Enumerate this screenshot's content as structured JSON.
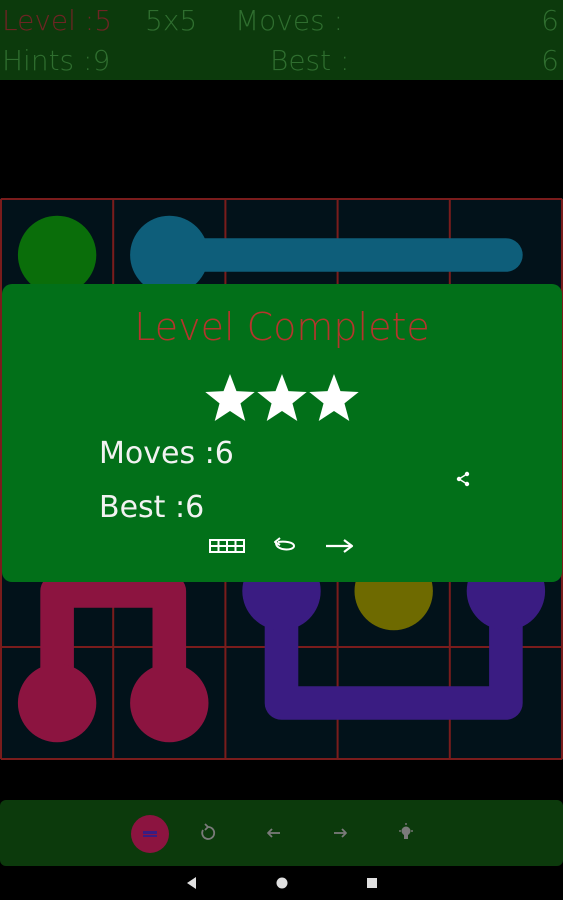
{
  "header": {
    "level_text": "Level :5",
    "size_text": "5x5",
    "moves_label": "Moves :",
    "moves_value": "6",
    "hints_text": "Hints :9",
    "best_label": "Best :",
    "best_value": "6"
  },
  "board": {
    "rows": 5,
    "cols": 5,
    "grid_color": "#7a1c1c",
    "cell_color": "#02121a",
    "flows": [
      {
        "color": "#0a6e0a",
        "endpoints": [
          [
            0,
            0
          ]
        ],
        "path": [
          [
            0,
            0
          ]
        ]
      },
      {
        "color": "#0e5e7a",
        "endpoints": [
          [
            0,
            1
          ]
        ],
        "path": [
          [
            0,
            1
          ],
          [
            0,
            2
          ],
          [
            0,
            3
          ],
          [
            0,
            4
          ]
        ]
      },
      {
        "color": "#8c1440",
        "endpoints": [
          [
            4,
            0
          ],
          [
            4,
            1
          ]
        ],
        "path": [
          [
            4,
            0
          ],
          [
            3,
            0
          ],
          [
            3,
            1
          ],
          [
            4,
            1
          ]
        ]
      },
      {
        "color": "#3a1c82",
        "endpoints": [
          [
            3,
            2
          ],
          [
            3,
            4
          ]
        ],
        "path": [
          [
            3,
            2
          ],
          [
            4,
            2
          ],
          [
            4,
            3
          ],
          [
            4,
            4
          ],
          [
            3,
            4
          ]
        ]
      },
      {
        "color": "#6e6a00",
        "endpoints": [
          [
            3,
            3
          ]
        ],
        "path": [
          [
            3,
            3
          ]
        ]
      }
    ]
  },
  "dialog": {
    "title": "Level Complete",
    "stars": 3,
    "moves_text": "Moves :6",
    "best_text": "Best :6",
    "bg_color": "#027019",
    "title_color": "#b5352c"
  },
  "toolbar": {
    "hint_color": "#8c1440",
    "icon_color": "#7a7a7a"
  }
}
